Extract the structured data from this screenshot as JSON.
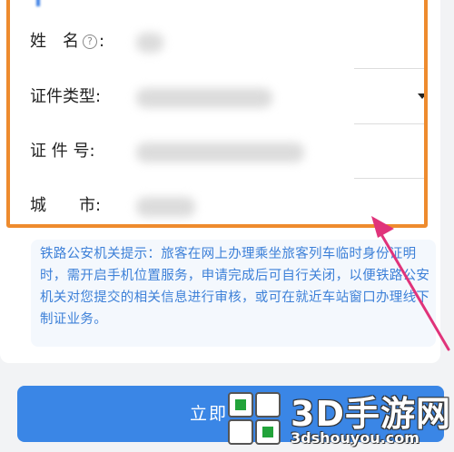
{
  "form": {
    "section_title": "",
    "fields": [
      {
        "label": "姓　名",
        "help": "?",
        "colon": ":"
      },
      {
        "label": "证件类型",
        "colon": ":"
      },
      {
        "label": "证 件 号",
        "colon": ":"
      },
      {
        "label": "城　　市",
        "colon": ":"
      }
    ]
  },
  "notice": {
    "text": "铁路公安机关提示：旅客在网上办理乘坐旅客列车临时身份证明时，需开启手机位置服务，申请完成后可自行关闭，以便铁路公安机关对您提交的相关信息进行审核，或可在就近车站窗口办理线下制证业务。"
  },
  "submit": {
    "label": "立即"
  },
  "watermark": {
    "brand": "3D手游网",
    "url": "3dshouyou.com"
  },
  "colors": {
    "highlight": "#ee8b2e",
    "arrow": "#e0337a",
    "primary": "#3a86e6",
    "notice_text": "#3d80d8"
  },
  "icons": {
    "dropdown": "caret-down-icon",
    "help": "question-circle-icon",
    "arrow": "pointer-arrow-icon"
  }
}
